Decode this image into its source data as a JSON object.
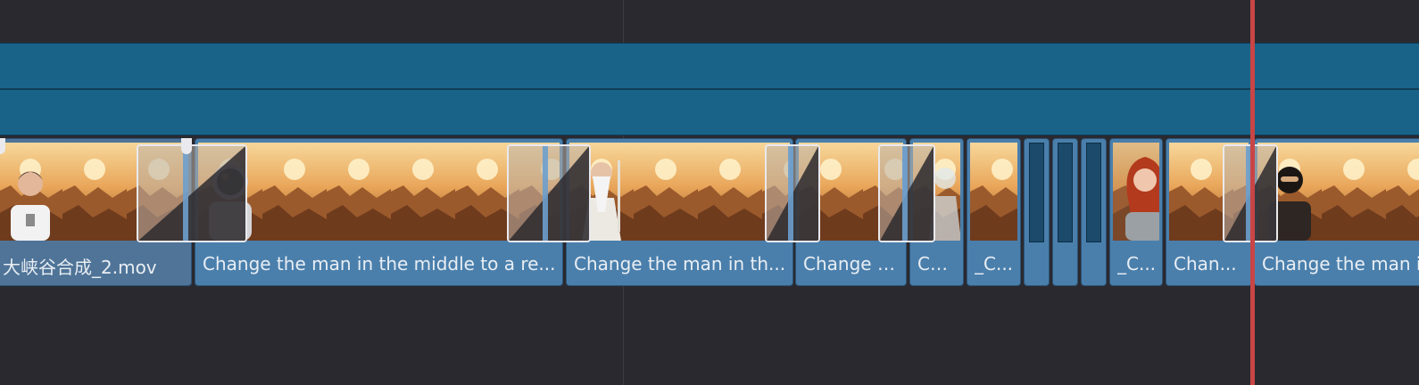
{
  "colors": {
    "background": "#2a292f",
    "audio_track": "#196389",
    "clip": "#4a7fac",
    "playhead": "#c94545"
  },
  "clips": [
    {
      "name": "大峡谷合成_2.mov",
      "thumb": "man-portrait"
    },
    {
      "name": "Change the man in the middle to a re...",
      "thumb": "astronaut"
    },
    {
      "name": "Change the man in th...",
      "thumb": "old-wizard"
    },
    {
      "name": "Change t...",
      "thumb": "canyon"
    },
    {
      "name": "Ch...",
      "thumb": "glass-figure"
    },
    {
      "name": "_C...",
      "thumb": "canyon"
    },
    {
      "name": "",
      "thumb": "empty"
    },
    {
      "name": "",
      "thumb": "empty"
    },
    {
      "name": "",
      "thumb": "empty"
    },
    {
      "name": "_C...",
      "thumb": "red-hair-woman"
    },
    {
      "name": "Chan...",
      "thumb": "canyon"
    },
    {
      "name": "Change the man i",
      "thumb": "ninja"
    }
  ]
}
